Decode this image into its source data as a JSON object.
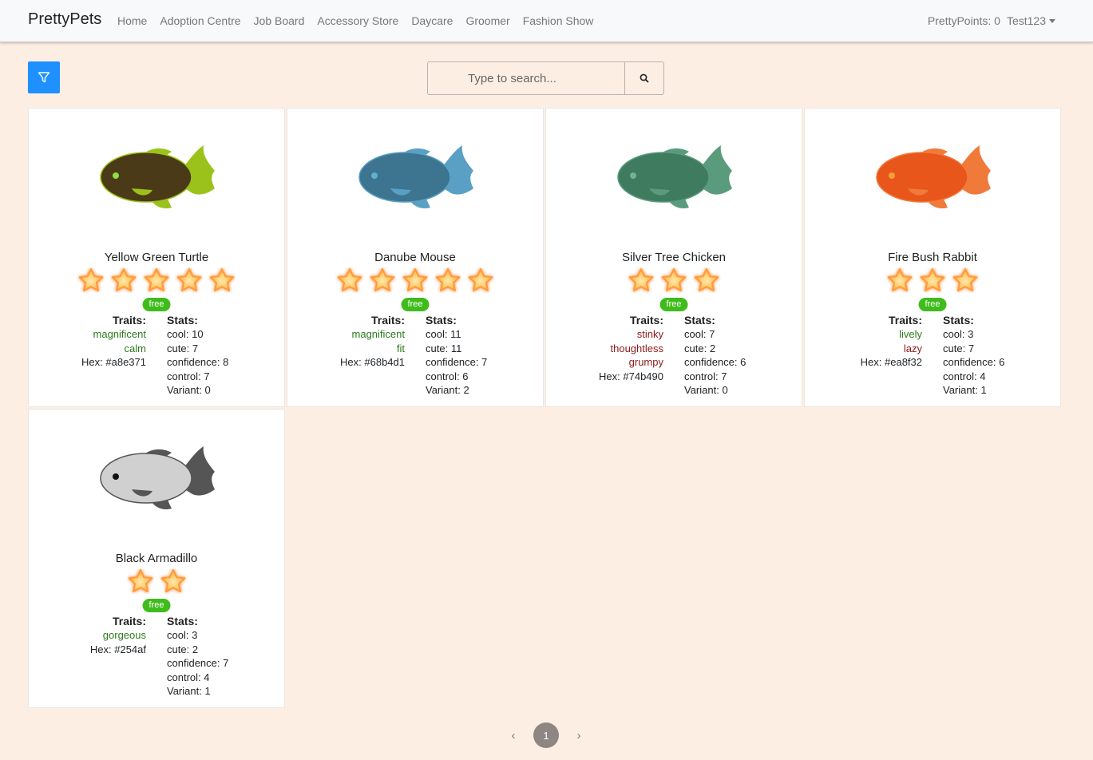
{
  "navbar": {
    "brand": "PrettyPets",
    "links": [
      "Home",
      "Adoption Centre",
      "Job Board",
      "Accessory Store",
      "Daycare",
      "Groomer",
      "Fashion Show"
    ],
    "points": "PrettyPoints: 0",
    "user": "Test123"
  },
  "search": {
    "placeholder": "Type to search..."
  },
  "labels": {
    "traits": "Traits:",
    "stats": "Stats:",
    "cool": "cool:",
    "cute": "cute:",
    "confidence": "confidence:",
    "control": "control:",
    "variant": "Variant:",
    "hex": "Hex:"
  },
  "colors": {
    "accent": "#1e90ff",
    "badge": "#3fbc1c",
    "background": "#fdeee4"
  },
  "pets": [
    {
      "name": "Yellow Green Turtle",
      "stars": 5,
      "badge": "free",
      "traits": [
        "magnificent",
        "calm"
      ],
      "trait_types": [
        "good",
        "good"
      ],
      "hex": "#a8e371",
      "cool": "10",
      "cute": "7",
      "confidence": "8",
      "control": "7",
      "variant": "0",
      "body_color": "#4b3a17",
      "fin_color": "#9bc21b",
      "eye_color": "#8fe040"
    },
    {
      "name": "Danube Mouse",
      "stars": 5,
      "badge": "free",
      "traits": [
        "magnificent",
        "fit"
      ],
      "trait_types": [
        "good",
        "good"
      ],
      "hex": "#68b4d1",
      "cool": "11",
      "cute": "11",
      "confidence": "7",
      "control": "6",
      "variant": "2",
      "body_color": "#3d7490",
      "fin_color": "#5aa0c4",
      "eye_color": "#5fb0d0"
    },
    {
      "name": "Silver Tree Chicken",
      "stars": 3,
      "badge": "free",
      "traits": [
        "stinky",
        "thoughtless",
        "grumpy"
      ],
      "trait_types": [
        "bad",
        "bad",
        "bad"
      ],
      "hex": "#74b490",
      "cool": "7",
      "cute": "2",
      "confidence": "6",
      "control": "7",
      "variant": "0",
      "body_color": "#3f7b5e",
      "fin_color": "#5a9b7c",
      "eye_color": "#6fb48f"
    },
    {
      "name": "Fire Bush Rabbit",
      "stars": 3,
      "badge": "free",
      "traits": [
        "lively",
        "lazy"
      ],
      "trait_types": [
        "good",
        "bad"
      ],
      "hex": "#ea8f32",
      "cool": "3",
      "cute": "7",
      "confidence": "6",
      "control": "4",
      "variant": "1",
      "body_color": "#e8561c",
      "fin_color": "#f07a3a",
      "eye_color": "#f5a030"
    },
    {
      "name": "Black Armadillo",
      "stars": 2,
      "badge": "free",
      "traits": [
        "gorgeous"
      ],
      "trait_types": [
        "good"
      ],
      "hex": "#254af",
      "cool": "3",
      "cute": "2",
      "confidence": "7",
      "control": "4",
      "variant": "1",
      "body_color": "#d0d0d0",
      "fin_color": "#555555",
      "eye_color": "#111111"
    }
  ],
  "pagination": {
    "prev": "‹",
    "current": "1",
    "next": "›"
  }
}
